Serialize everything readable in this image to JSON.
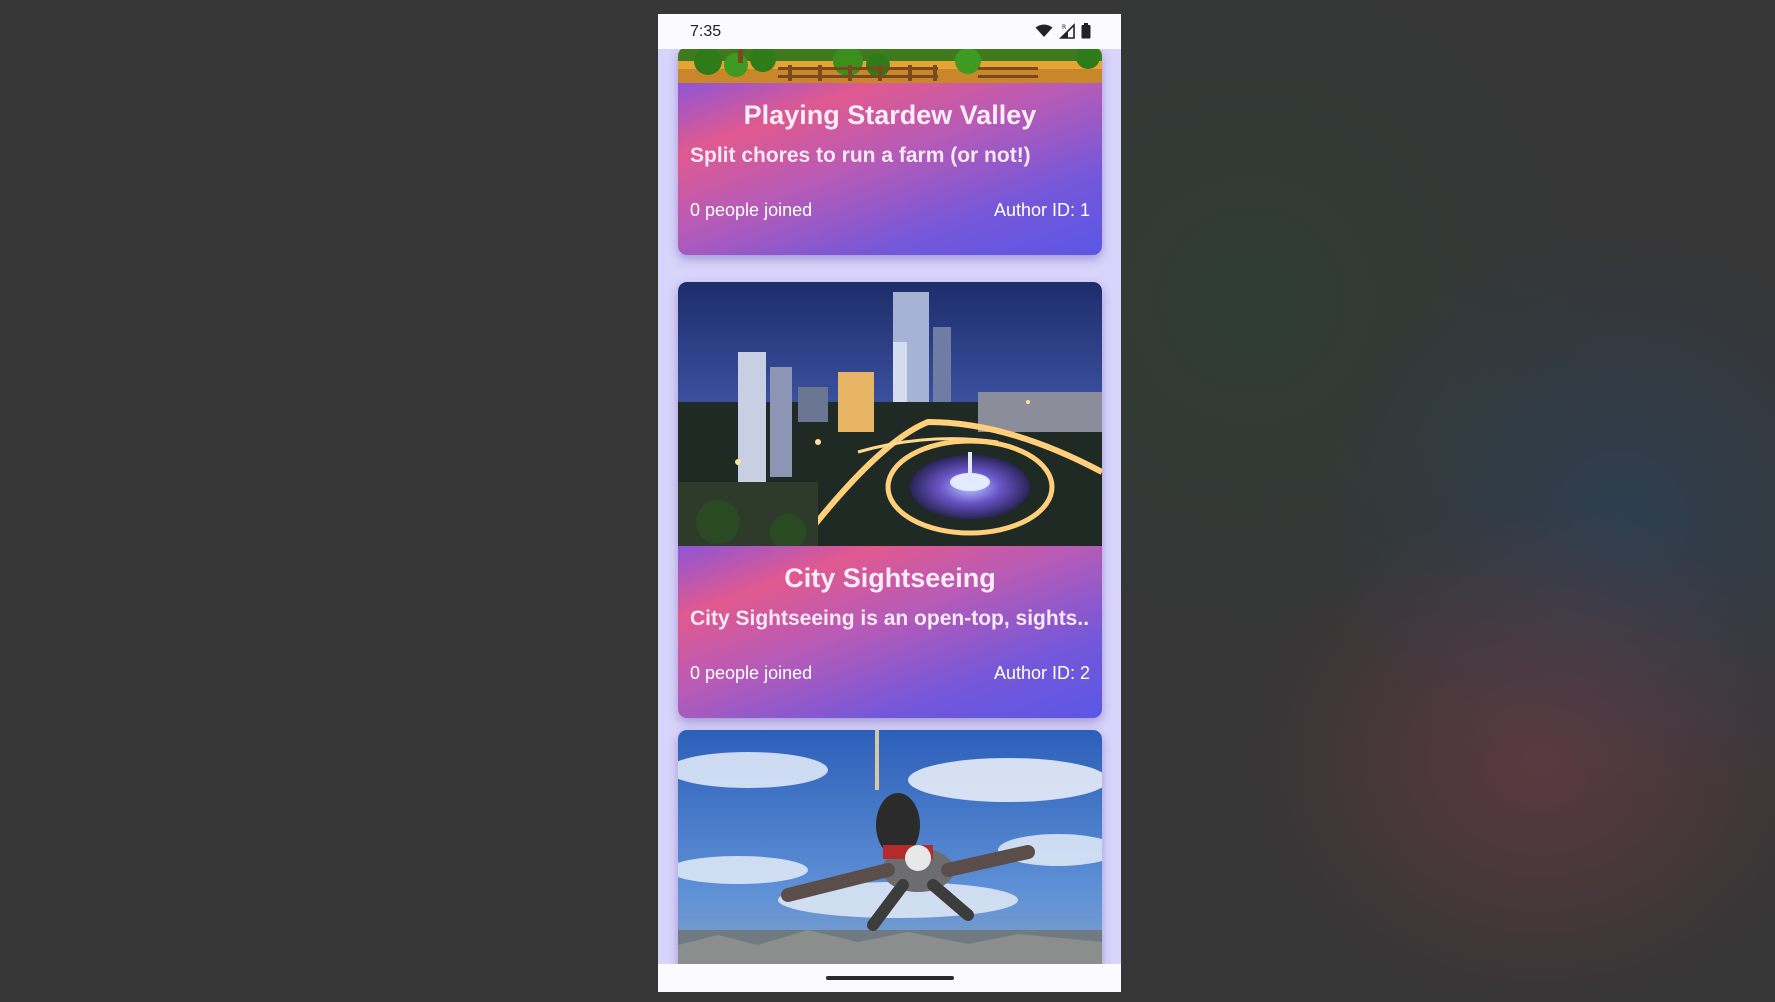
{
  "status_bar": {
    "time": "7:35",
    "icons": [
      "wifi-icon",
      "signal-icon",
      "battery-icon"
    ]
  },
  "colors": {
    "app_background": "#d9d4fb",
    "card_gradient": [
      "#e0598f",
      "#7457da",
      "#5b57e6"
    ],
    "text": "#ffffff"
  },
  "cards": [
    {
      "title": "Playing Stardew Valley",
      "description": "Split chores to run a farm (or not!)",
      "joined": "0 people joined",
      "author": "Author ID: 1",
      "image": "stardew-valley-farm-image"
    },
    {
      "title": "City Sightseeing",
      "description": "City Sightseeing is an open-top, sights...",
      "joined": "0 people joined",
      "author": "Author ID: 2",
      "image": "city-night-skyline-image"
    },
    {
      "image": "skydiving-image"
    }
  ]
}
